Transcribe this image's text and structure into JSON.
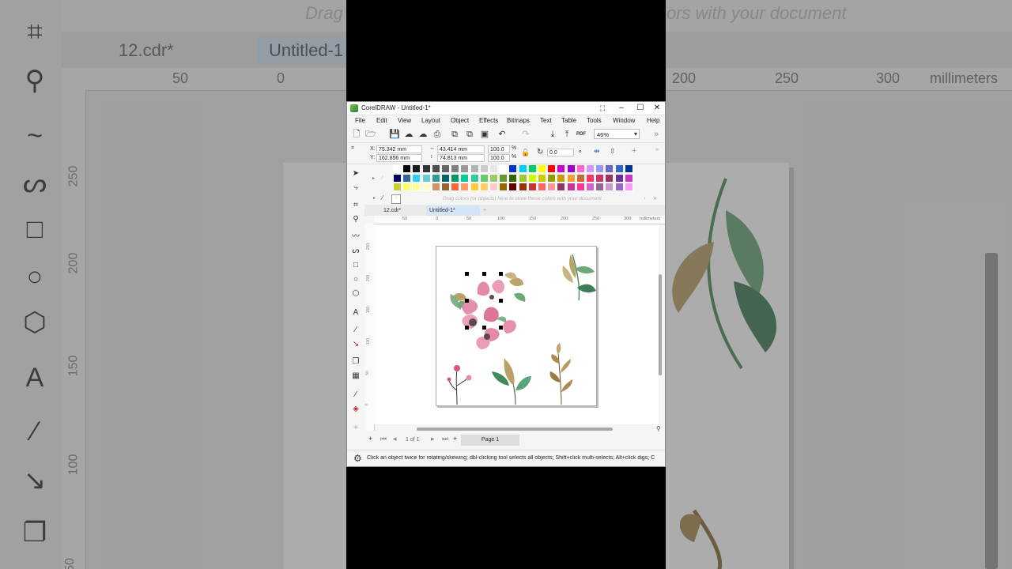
{
  "background": {
    "hint": "Drag colors (or objects) here to store these colors with your document",
    "hint_left": "Drag",
    "hint_right": "ors with your document",
    "tabs": [
      "12.cdr*",
      "Untitled-1"
    ],
    "ruler_ticks": [
      "50",
      "0",
      "200",
      "250",
      "300",
      "millimeters"
    ],
    "vruler_ticks": [
      "250",
      "200",
      "150",
      "100",
      "50"
    ]
  },
  "window": {
    "title": "CorelDRAW - Untitled-1*",
    "controls": {
      "minimize": "‒",
      "maximize": "☐",
      "close": "✕"
    }
  },
  "menu": [
    "File",
    "Edit",
    "View",
    "Layout",
    "Object",
    "Effects",
    "Bitmaps",
    "Text",
    "Table",
    "Tools",
    "Window",
    "Help"
  ],
  "toolbar": {
    "zoom": "46%",
    "pdf_label": "PDF"
  },
  "property_bar": {
    "x_label": "X:",
    "x_value": "75.342 mm",
    "y_label": "Y:",
    "y_value": "162.856 mm",
    "w_value": "43.414 mm",
    "h_value": "74.813 mm",
    "scale_w": "100.0",
    "scale_h": "100.0",
    "percent": "%",
    "rotation": "0.0"
  },
  "palette": {
    "rows": [
      [
        "#ffffff",
        "#000000",
        "#1a1a1a",
        "#333333",
        "#4d4d4d",
        "#666666",
        "#808080",
        "#999999",
        "#b3b3b3",
        "#cccccc",
        "#e6e6e6",
        "#ffffff",
        "#0033cc",
        "#00ccff",
        "#00cc66",
        "#ffff00",
        "#ff0000",
        "#cc00cc",
        "#9900cc",
        "#ff66cc",
        "#cc99ff",
        "#9999ff",
        "#6666cc",
        "#3366cc",
        "#003399"
      ],
      [
        "#000066",
        "#336699",
        "#33ccff",
        "#66cccc",
        "#339999",
        "#006666",
        "#009966",
        "#00cc99",
        "#33cc99",
        "#66cc66",
        "#99cc66",
        "#669933",
        "#336600",
        "#99cc33",
        "#ccff00",
        "#cccc00",
        "#999900",
        "#cc9900",
        "#ff9933",
        "#cc6633",
        "#ff3366",
        "#cc3366",
        "#993366",
        "#663399",
        "#cc33cc"
      ],
      [
        "#cccc33",
        "#ffff66",
        "#ffff99",
        "#ffffcc",
        "#cc9966",
        "#996633",
        "#ff6633",
        "#ff9966",
        "#ffcc33",
        "#ffcc66",
        "#ffcccc",
        "#996600",
        "#660000",
        "#993300",
        "#cc3333",
        "#ff6666",
        "#ff9999",
        "#993366",
        "#cc3399",
        "#ff3399",
        "#cc66cc",
        "#996699",
        "#cc99cc",
        "#9966cc",
        "#ff99ff"
      ]
    ]
  },
  "drag_hint": "Drag colors (or objects) here to store these colors with your document",
  "tabs": [
    {
      "label": "12.cdr*",
      "active": false
    },
    {
      "label": "Untitled-1*",
      "active": true
    },
    {
      "label": "+",
      "active": false
    }
  ],
  "ruler": {
    "ticks": [
      "50",
      "0",
      "50",
      "100",
      "150",
      "200",
      "250",
      "300"
    ],
    "unit": "millimeters",
    "v_ticks": [
      "250",
      "200",
      "150",
      "100",
      "50",
      "0"
    ],
    "v_unit": "millimeters"
  },
  "navigation": {
    "page_count": "1 of 1",
    "page_tab": "Page 1",
    "add": "+"
  },
  "status": {
    "text": "Click an object twice for rotating/skewing; dbl-clicking tool selects all objects; Shift+click multi-selects; Alt+click digs; C"
  }
}
